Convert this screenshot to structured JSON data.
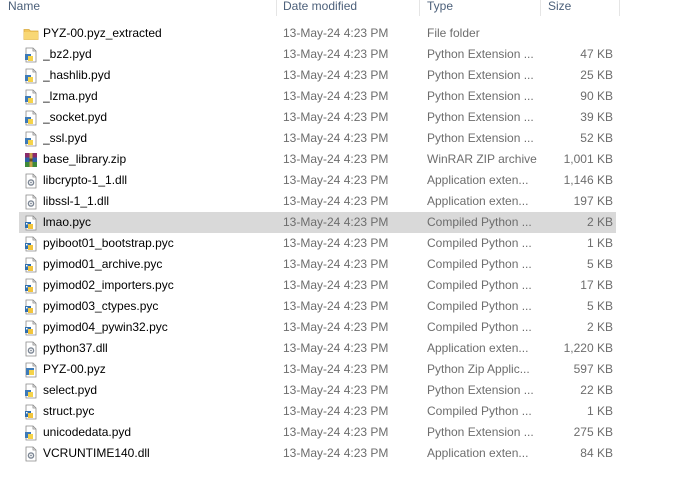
{
  "columns": {
    "name": "Name",
    "date": "Date modified",
    "type": "Type",
    "size": "Size"
  },
  "files": [
    {
      "name": "PYZ-00.pyz_extracted",
      "date": "13-May-24 4:23 PM",
      "type": "File folder",
      "size": "",
      "icon": "folder-icon"
    },
    {
      "name": "_bz2.pyd",
      "date": "13-May-24 4:23 PM",
      "type": "Python Extension ...",
      "size": "47 KB",
      "icon": "pyd-file-icon"
    },
    {
      "name": "_hashlib.pyd",
      "date": "13-May-24 4:23 PM",
      "type": "Python Extension ...",
      "size": "25 KB",
      "icon": "pyd-file-icon"
    },
    {
      "name": "_lzma.pyd",
      "date": "13-May-24 4:23 PM",
      "type": "Python Extension ...",
      "size": "90 KB",
      "icon": "pyd-file-icon"
    },
    {
      "name": "_socket.pyd",
      "date": "13-May-24 4:23 PM",
      "type": "Python Extension ...",
      "size": "39 KB",
      "icon": "pyd-file-icon"
    },
    {
      "name": "_ssl.pyd",
      "date": "13-May-24 4:23 PM",
      "type": "Python Extension ...",
      "size": "52 KB",
      "icon": "pyd-file-icon"
    },
    {
      "name": "base_library.zip",
      "date": "13-May-24 4:23 PM",
      "type": "WinRAR ZIP archive",
      "size": "1,001 KB",
      "icon": "winrar-archive-icon"
    },
    {
      "name": "libcrypto-1_1.dll",
      "date": "13-May-24 4:23 PM",
      "type": "Application exten...",
      "size": "1,146 KB",
      "icon": "dll-file-icon"
    },
    {
      "name": "libssl-1_1.dll",
      "date": "13-May-24 4:23 PM",
      "type": "Application exten...",
      "size": "197 KB",
      "icon": "dll-file-icon"
    },
    {
      "name": "lmao.pyc",
      "date": "13-May-24 4:23 PM",
      "type": "Compiled Python ...",
      "size": "2 KB",
      "icon": "pyc-file-icon",
      "selected": true
    },
    {
      "name": "pyiboot01_bootstrap.pyc",
      "date": "13-May-24 4:23 PM",
      "type": "Compiled Python ...",
      "size": "1 KB",
      "icon": "pyc-file-icon"
    },
    {
      "name": "pyimod01_archive.pyc",
      "date": "13-May-24 4:23 PM",
      "type": "Compiled Python ...",
      "size": "5 KB",
      "icon": "pyc-file-icon"
    },
    {
      "name": "pyimod02_importers.pyc",
      "date": "13-May-24 4:23 PM",
      "type": "Compiled Python ...",
      "size": "17 KB",
      "icon": "pyc-file-icon"
    },
    {
      "name": "pyimod03_ctypes.pyc",
      "date": "13-May-24 4:23 PM",
      "type": "Compiled Python ...",
      "size": "5 KB",
      "icon": "pyc-file-icon"
    },
    {
      "name": "pyimod04_pywin32.pyc",
      "date": "13-May-24 4:23 PM",
      "type": "Compiled Python ...",
      "size": "2 KB",
      "icon": "pyc-file-icon"
    },
    {
      "name": "python37.dll",
      "date": "13-May-24 4:23 PM",
      "type": "Application exten...",
      "size": "1,220 KB",
      "icon": "dll-file-icon"
    },
    {
      "name": "PYZ-00.pyz",
      "date": "13-May-24 4:23 PM",
      "type": "Python Zip Applic...",
      "size": "597 KB",
      "icon": "pyz-file-icon"
    },
    {
      "name": "select.pyd",
      "date": "13-May-24 4:23 PM",
      "type": "Python Extension ...",
      "size": "22 KB",
      "icon": "pyd-file-icon"
    },
    {
      "name": "struct.pyc",
      "date": "13-May-24 4:23 PM",
      "type": "Compiled Python ...",
      "size": "1 KB",
      "icon": "pyc-file-icon"
    },
    {
      "name": "unicodedata.pyd",
      "date": "13-May-24 4:23 PM",
      "type": "Python Extension ...",
      "size": "275 KB",
      "icon": "pyd-file-icon"
    },
    {
      "name": "VCRUNTIME140.dll",
      "date": "13-May-24 4:23 PM",
      "type": "Application exten...",
      "size": "84 KB",
      "icon": "dll-file-icon"
    }
  ],
  "colors": {
    "header_text": "#4c607a",
    "secondary_text": "#6d6d6d",
    "selected_row": "#d9d9d9",
    "folder": "#f3c75c",
    "python_blue": "#3d7ab8",
    "python_yellow": "#f5d34a"
  }
}
